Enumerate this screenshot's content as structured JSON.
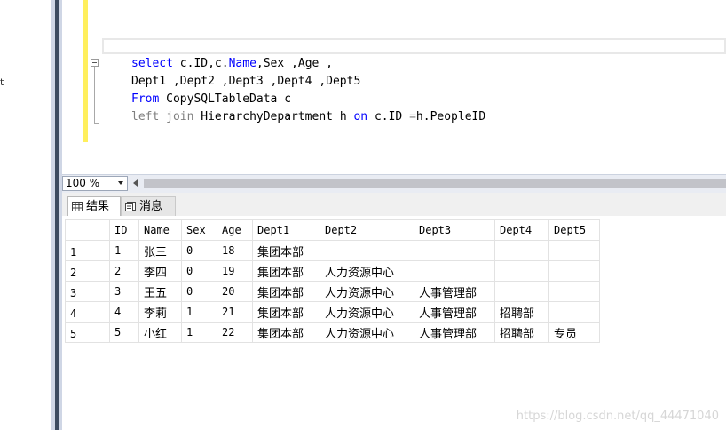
{
  "left_fragment": "t",
  "editor": {
    "lines": [
      [
        {
          "t": "select",
          "c": "kw"
        },
        {
          "t": " c.ID,c.",
          "c": "ident"
        },
        {
          "t": "Name",
          "c": "kw"
        },
        {
          "t": ",Sex ,Age ,",
          "c": "ident"
        }
      ],
      [
        {
          "t": "Dept1 ,Dept2 ,Dept3 ,Dept4 ,Dept5",
          "c": "ident"
        }
      ],
      [
        {
          "t": "From",
          "c": "kw"
        },
        {
          "t": " CopySQLTableData c",
          "c": "ident"
        }
      ],
      [
        {
          "t": "left join",
          "c": "gray"
        },
        {
          "t": " HierarchyDepartment h ",
          "c": "ident"
        },
        {
          "t": "on",
          "c": "kw"
        },
        {
          "t": " c.ID ",
          "c": "ident"
        },
        {
          "t": "=",
          "c": "gray"
        },
        {
          "t": "h.PeopleID",
          "c": "ident"
        }
      ]
    ]
  },
  "zoom": {
    "value": "100 %"
  },
  "tabs": {
    "results": "结果",
    "messages": "消息"
  },
  "grid": {
    "columns": [
      "ID",
      "Name",
      "Sex",
      "Age",
      "Dept1",
      "Dept2",
      "Dept3",
      "Dept4",
      "Dept5"
    ],
    "rows": [
      {
        "n": "1",
        "cells": [
          "1",
          "张三",
          "0",
          "18",
          "集团本部",
          "",
          "",
          "",
          ""
        ]
      },
      {
        "n": "2",
        "cells": [
          "2",
          "李四",
          "0",
          "19",
          "集团本部",
          "人力资源中心",
          "",
          "",
          ""
        ]
      },
      {
        "n": "3",
        "cells": [
          "3",
          "王五",
          "0",
          "20",
          "集团本部",
          "人力资源中心",
          "人事管理部",
          "",
          ""
        ]
      },
      {
        "n": "4",
        "cells": [
          "4",
          "李莉",
          "1",
          "21",
          "集团本部",
          "人力资源中心",
          "人事管理部",
          "招聘部",
          ""
        ]
      },
      {
        "n": "5",
        "cells": [
          "5",
          "小红",
          "1",
          "22",
          "集团本部",
          "人力资源中心",
          "人事管理部",
          "招聘部",
          "专员"
        ]
      }
    ]
  },
  "watermark": "https://blog.csdn.net/qq_44471040"
}
